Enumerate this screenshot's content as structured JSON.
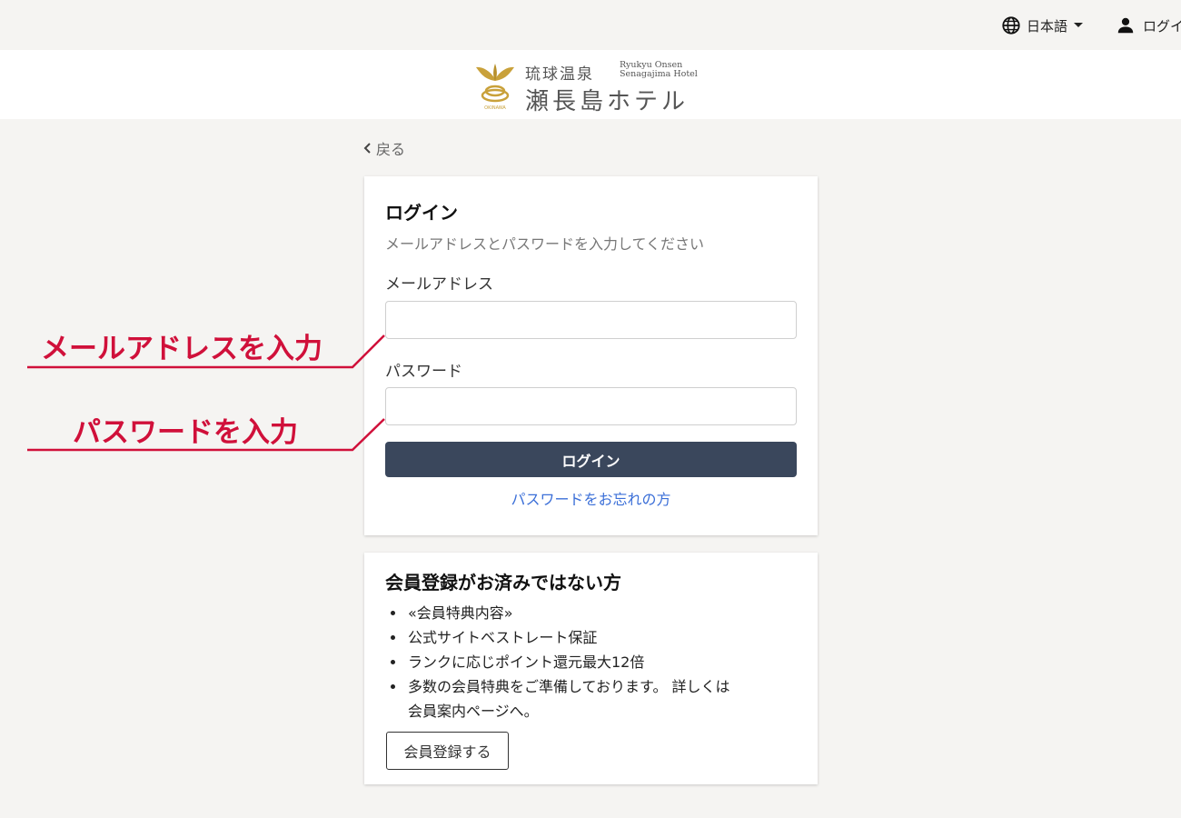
{
  "topbar": {
    "language": "日本語",
    "login_link": "ログイン"
  },
  "logo": {
    "jp_small": "琉球温泉",
    "en_line1": "Ryukyu Onsen",
    "en_line2": "Senagajima Hotel",
    "jp_big": "瀬長島ホテル",
    "mark_text": "OKINAWA",
    "brand_gold": "#c9a13a"
  },
  "back": {
    "label": "戻る"
  },
  "login_card": {
    "title": "ログイン",
    "subtitle": "メールアドレスとパスワードを入力してください",
    "email_label": "メールアドレス",
    "email_value": "",
    "password_label": "パスワード",
    "password_value": "",
    "submit_label": "ログイン",
    "forgot_label": "パスワードをお忘れの方"
  },
  "member_card": {
    "title": "会員登録がお済みではない方",
    "items": [
      "«会員特典内容»",
      "公式サイトベストレート保証",
      "ランクに応じポイント還元最大12倍",
      "多数の会員特典をご準備しております。 詳しくは",
      "会員案内ページへ。"
    ],
    "register_label": "会員登録する"
  },
  "annotations": {
    "email_hint": "メールアドレスを入力",
    "password_hint": "パスワードを入力",
    "color": "#d0103a"
  },
  "colors": {
    "page_bg": "#f5f4f2",
    "button_bg": "#3a475c",
    "link": "#3b6fd8"
  }
}
